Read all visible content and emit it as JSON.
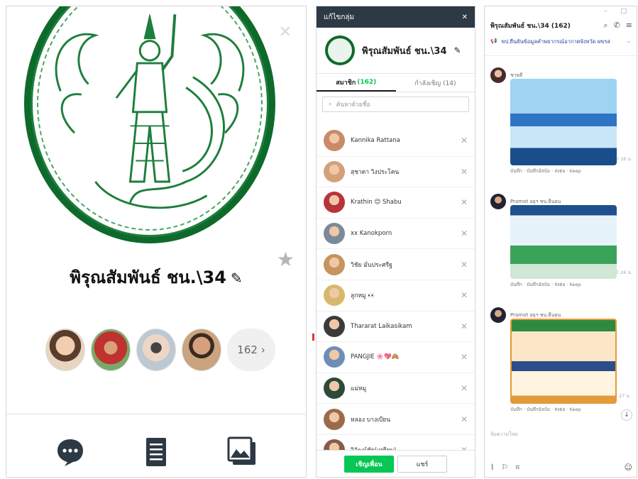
{
  "profile": {
    "group_name": "พิรุณสัมพันธ์ ชน.\\34",
    "edit_icon": "pencil-icon",
    "member_count": "162",
    "member_count_suffix": "›",
    "close_glyph": "✕",
    "favorite_icon": "star-icon",
    "star_glyph": "★",
    "actions": [
      "chat-icon",
      "notes-icon",
      "album-icon"
    ]
  },
  "edit_group": {
    "title": "แก้ไขกลุ่ม",
    "close_glyph": "✕",
    "group_name": "พิรุณสัมพันธ์ ชน.\\34",
    "tabs": [
      {
        "label": "สมาชิก",
        "count": "(162)"
      },
      {
        "label": "กำลังเชิญ (14)",
        "count": ""
      }
    ],
    "search_placeholder": "ค้นหาด้วยชื่อ",
    "members": [
      {
        "name": "Kannika Rattana",
        "color": "#c98a6a"
      },
      {
        "name": "สุชาดา วิงประโคน",
        "color": "#d4a07a"
      },
      {
        "name": "Krathin 😊 Shabu",
        "color": "#b8343a"
      },
      {
        "name": "xx Kanokporn",
        "color": "#7b8a9a"
      },
      {
        "name": "วิชัย มั่นประศรีฐ",
        "color": "#c7935e"
      },
      {
        "name": "ลูกหมู 👀",
        "color": "#d8b86a"
      },
      {
        "name": "Thararat Laikasikam",
        "color": "#3b3b3b"
      },
      {
        "name": "PANGJIE 🌸💖🙈",
        "color": "#6d8fb5"
      },
      {
        "name": "แม่หมู",
        "color": "#2d4a3a"
      },
      {
        "name": "หลอง บางเบียน",
        "color": "#9a6b4a"
      },
      {
        "name": "วิวัฒน์ชัย(เหยียบ)",
        "color": "#8a5a4a"
      }
    ],
    "remove_glyph": "✕",
    "invite_label": "เชิญเพื่อน",
    "share_label": "แชร์"
  },
  "chat": {
    "window_controls": "– □",
    "title": "พิรุณสัมพันธ์ ชน.\\34 (162)",
    "announcement": "ขป.ยืนยันข้อมูลคำพยากรณ์อากาศจังหวัด ผขรส",
    "messages": [
      {
        "sender": "ชายดี",
        "time": "7.16 น.",
        "actions": "บันทึก · บันทึกอัลบ้ม · ส่งต่อ · Keep",
        "card_color": "#2e75c6"
      },
      {
        "sender": "Pramot อยุฯ ชน.ยืนยน",
        "time": "7.26 น.",
        "actions": "บันทึก · บันทึกอัลบ้ม · ส่งต่อ · Keep",
        "card_color": "#3aa35a"
      },
      {
        "sender": "Pramot อยุฯ ชน.ยืนยน",
        "time": "7.27 น.",
        "actions": "บันทึก · บันทึกอัลบ้ม · ส่งต่อ · Keep",
        "card_color": "#e39a3b"
      }
    ],
    "input_placeholder": "ข้อความใหม่"
  }
}
